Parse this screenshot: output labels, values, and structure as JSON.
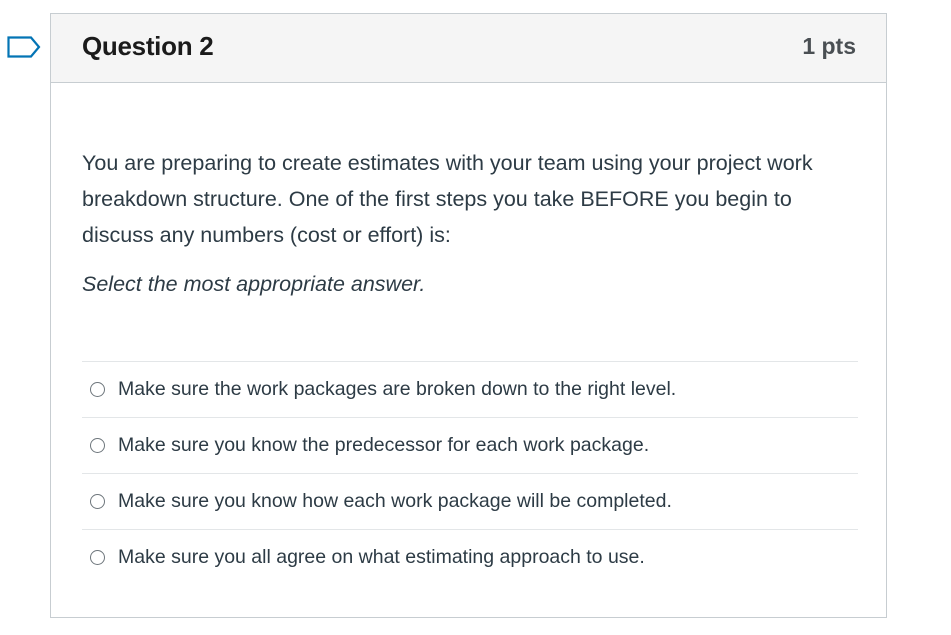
{
  "flag": {
    "icon": "bookmark-flag-icon",
    "color": "#0374b5"
  },
  "question": {
    "title": "Question 2",
    "points": "1 pts",
    "text": "You are preparing to create estimates with your team using your project work breakdown structure. One of the first steps you take BEFORE you begin to discuss any numbers (cost or effort) is:",
    "instruction": "Select the most appropriate answer."
  },
  "answers": [
    {
      "label": "Make sure the work packages are broken down to the right level.",
      "selected": false
    },
    {
      "label": "Make sure you know the predecessor for each work package.",
      "selected": false
    },
    {
      "label": "Make sure you know how each work package will be completed.",
      "selected": false
    },
    {
      "label": "Make sure you all agree on what estimating approach to use.",
      "selected": false
    }
  ]
}
